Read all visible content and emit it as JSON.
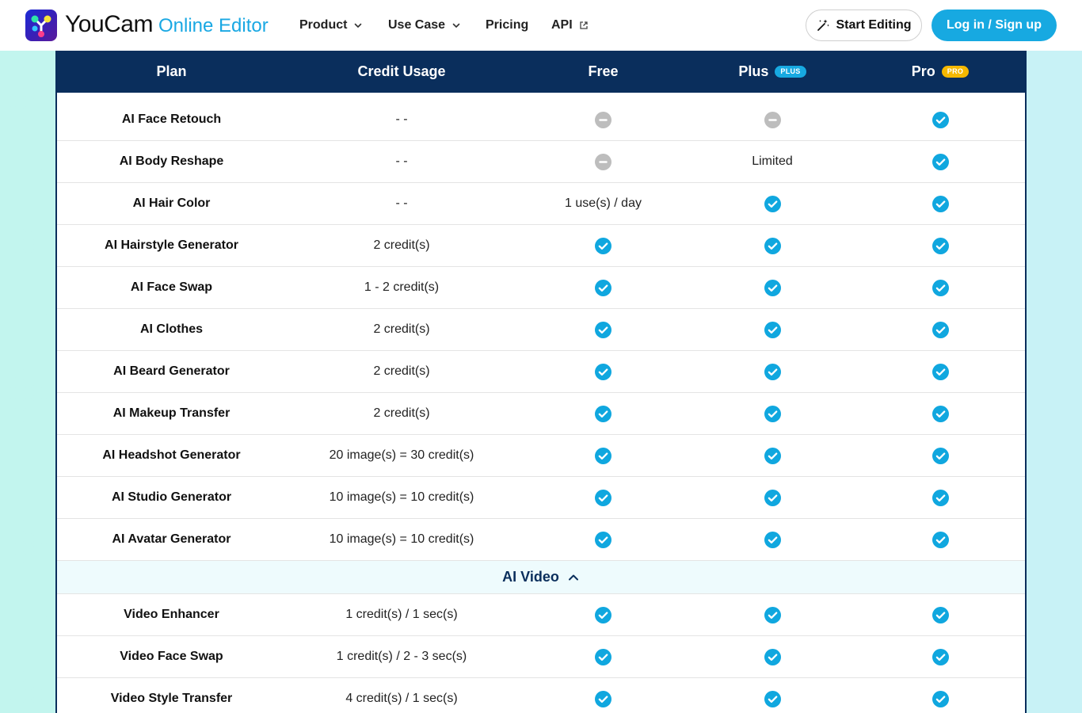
{
  "nav": {
    "brand_main": "YouCam",
    "brand_sub": "Online Editor",
    "items": [
      {
        "label": "Product"
      },
      {
        "label": "Use Case"
      },
      {
        "label": "Pricing"
      },
      {
        "label": "API"
      }
    ],
    "start_editing": "Start Editing",
    "login": "Log in / Sign up"
  },
  "table": {
    "headers": {
      "plan": "Plan",
      "credit_usage": "Credit Usage",
      "free": "Free",
      "plus": "Plus",
      "plus_badge": "PLUS",
      "pro": "Pro",
      "pro_badge": "PRO"
    },
    "rows": [
      {
        "name": "AI Face Retouch",
        "credit": "- -",
        "free": "no",
        "plus": "no",
        "pro": "yes"
      },
      {
        "name": "AI Body Reshape",
        "credit": "- -",
        "free": "no",
        "plus": "Limited",
        "pro": "yes"
      },
      {
        "name": "AI Hair Color",
        "credit": "- -",
        "free": "1 use(s) / day",
        "plus": "yes",
        "pro": "yes"
      },
      {
        "name": "AI Hairstyle Generator",
        "credit": "2 credit(s)",
        "free": "yes",
        "plus": "yes",
        "pro": "yes"
      },
      {
        "name": "AI Face Swap",
        "credit": "1 - 2 credit(s)",
        "free": "yes",
        "plus": "yes",
        "pro": "yes"
      },
      {
        "name": "AI Clothes",
        "credit": "2 credit(s)",
        "free": "yes",
        "plus": "yes",
        "pro": "yes"
      },
      {
        "name": "AI Beard Generator",
        "credit": "2 credit(s)",
        "free": "yes",
        "plus": "yes",
        "pro": "yes"
      },
      {
        "name": "AI Makeup Transfer",
        "credit": "2 credit(s)",
        "free": "yes",
        "plus": "yes",
        "pro": "yes"
      },
      {
        "name": "AI Headshot Generator",
        "credit": "20 image(s) = 30 credit(s)",
        "free": "yes",
        "plus": "yes",
        "pro": "yes"
      },
      {
        "name": "AI Studio Generator",
        "credit": "10 image(s) = 10 credit(s)",
        "free": "yes",
        "plus": "yes",
        "pro": "yes"
      },
      {
        "name": "AI Avatar Generator",
        "credit": "10 image(s) = 10 credit(s)",
        "free": "yes",
        "plus": "yes",
        "pro": "yes"
      }
    ],
    "section": {
      "label": "AI Video"
    },
    "video_rows": [
      {
        "name": "Video Enhancer",
        "credit": "1 credit(s) / 1 sec(s)",
        "free": "yes",
        "plus": "yes",
        "pro": "yes"
      },
      {
        "name": "Video Face Swap",
        "credit": "1 credit(s) / 2 - 3 sec(s)",
        "free": "yes",
        "plus": "yes",
        "pro": "yes"
      },
      {
        "name": "Video Style Transfer",
        "credit": "4 credit(s) / 1 sec(s)",
        "free": "yes",
        "plus": "yes",
        "pro": "yes"
      }
    ]
  },
  "colors": {
    "header_bg": "#0a2e5c",
    "accent": "#17a9e1",
    "check": "#10a7df",
    "unavailable": "#bdbdbd",
    "pro_badge": "#f5b800"
  },
  "icons": {
    "included": "check-circle-icon",
    "not_included": "minus-circle-icon"
  }
}
